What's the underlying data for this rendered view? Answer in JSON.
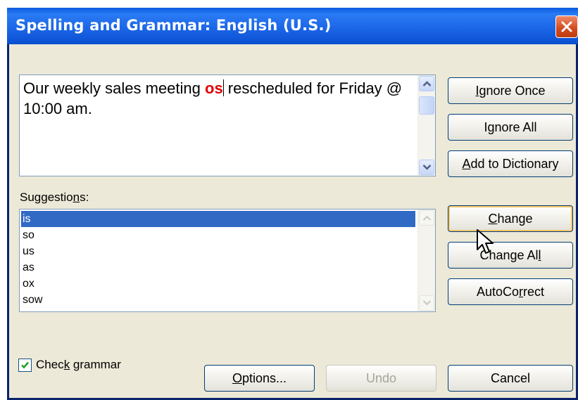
{
  "window": {
    "title": "Spelling and Grammar: English (U.S.)"
  },
  "sentence": {
    "before": "Our weekly sales meeting ",
    "error": "os",
    "after": " rescheduled for Friday @ 10:00 am."
  },
  "suggestions": {
    "label": "Suggestions:",
    "items": [
      "is",
      "so",
      "us",
      "as",
      "ox",
      "sow"
    ],
    "selected": "is"
  },
  "buttons": {
    "ignore_once": "Ignore Once",
    "ignore_all": "Ignore All",
    "add_to_dictionary": "Add to Dictionary",
    "change": "Change",
    "change_all": "Change All",
    "autocorrect": "AutoCorrect",
    "options": "Options...",
    "undo": "Undo",
    "cancel": "Cancel"
  },
  "check_grammar": {
    "label": "Check grammar",
    "checked": true
  },
  "colors": {
    "titlebar": "#0a4fd0",
    "error_word": "#e00000",
    "selection": "#316ac5",
    "dialog_bg": "#ece9d8"
  }
}
